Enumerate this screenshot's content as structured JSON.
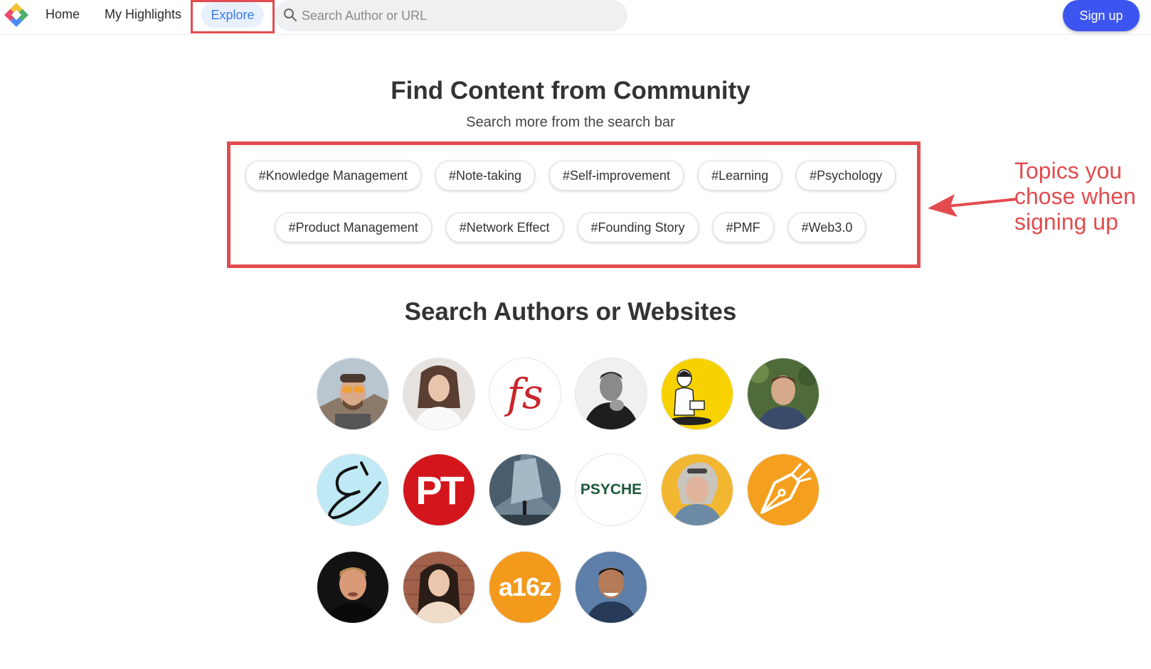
{
  "nav": {
    "home": "Home",
    "my_highlights": "My Highlights",
    "explore": "Explore",
    "search_placeholder": "Search Author or URL",
    "signup": "Sign up"
  },
  "find": {
    "title": "Find Content from Community",
    "subtitle": "Search more from the search bar"
  },
  "topics": {
    "row1": [
      "#Knowledge Management",
      "#Note-taking",
      "#Self-improvement",
      "#Learning",
      "#Psychology"
    ],
    "row2": [
      "#Product Management",
      "#Network Effect",
      "#Founding Story",
      "#PMF",
      "#Web3.0"
    ]
  },
  "annotation": {
    "text": "Topics you\nchose when\nsigning up"
  },
  "authors": {
    "title": "Search Authors or Websites",
    "logo_text": {
      "fs": "fs",
      "pt": "PT",
      "psyche": "PSYCHE",
      "a16z": "a16z"
    }
  },
  "colors": {
    "accent_blue": "#3d55f0",
    "explore_blue": "#3a7bea",
    "annotation_red": "#e24c4f"
  }
}
